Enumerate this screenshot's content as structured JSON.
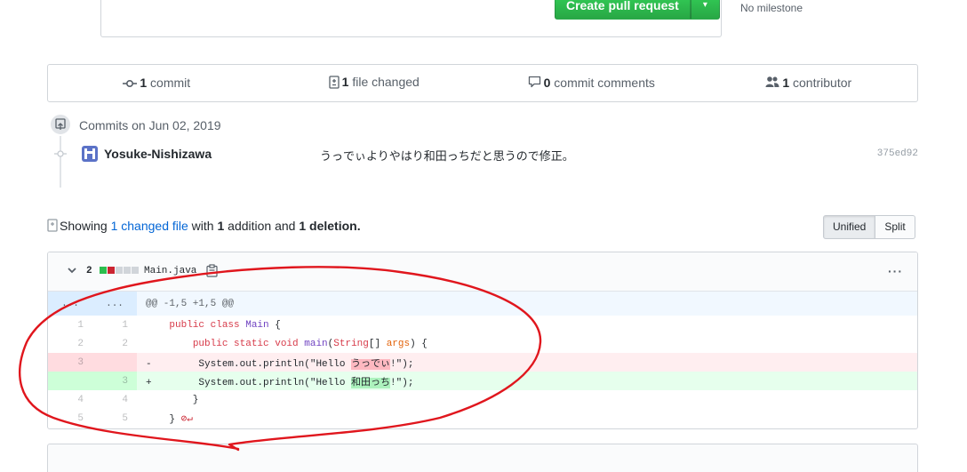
{
  "pr": {
    "create_label": "Create pull request",
    "caret": "▾",
    "milestone": "No milestone"
  },
  "summary": {
    "commits_count": "1",
    "commits_label": "commit",
    "files_count": "1",
    "files_label": "file changed",
    "comments_count": "0",
    "comments_label": "commit comments",
    "contributors_count": "1",
    "contributors_label": "contributor"
  },
  "commits": {
    "date_label": "Commits on Jun 02, 2019",
    "author": "Yosuke-Nishizawa",
    "message": "うっでぃよりやはり和田っちだと思うので修正。",
    "sha": "375ed92"
  },
  "diffstat": {
    "showing": "Showing",
    "changed_link": "1 changed file",
    "with": "with",
    "additions_count": "1",
    "addition_word": "addition",
    "and": "and",
    "deletions_count": "1",
    "deletion_word": "deletion."
  },
  "view_toggle": {
    "unified": "Unified",
    "split": "Split"
  },
  "file": {
    "changes_count": "2",
    "name": "Main.java",
    "menu": "···",
    "hunk_left": "...",
    "hunk_right": "...",
    "hunk_header": "@@ -1,5 +1,5 @@",
    "lines": {
      "l1_old": "1",
      "l1_new": "1",
      "l2_old": "2",
      "l2_new": "2",
      "del_old": "3",
      "del_marker": "-",
      "del_code_pre": "        System.out.println(\"Hello ",
      "del_highlight": "うっでぃ",
      "del_code_post": "!\");",
      "add_new": "3",
      "add_marker": "+",
      "add_code_pre": "        System.out.println(\"Hello ",
      "add_highlight": "和田っち",
      "add_code_post": "!\");",
      "l4_old": "4",
      "l4_new": "4",
      "l4_code": "    }",
      "l5_old": "5",
      "l5_new": "5",
      "l5_code": "}"
    }
  },
  "colors": {
    "primary_button": "#28a745",
    "link": "#0366d6",
    "annotation_red": "#e0161d",
    "addition_bg": "#e6ffed",
    "deletion_bg": "#ffeef0"
  },
  "icons": [
    "git-commit-icon",
    "file-diff-icon",
    "comment-icon",
    "people-icon",
    "repo-push-icon",
    "clippy-icon",
    "chevron-down-icon",
    "kebab-icon"
  ]
}
